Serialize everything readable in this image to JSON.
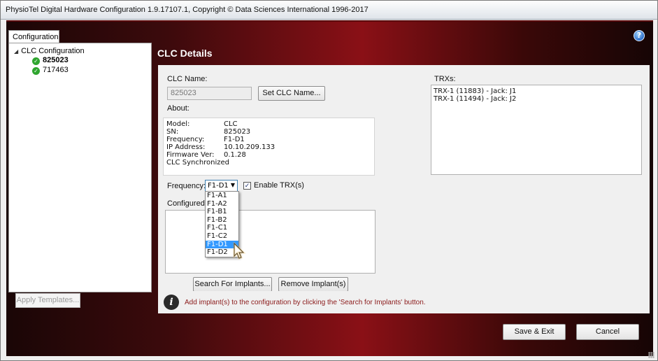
{
  "window": {
    "title": "PhysioTel Digital Hardware Configuration 1.9.17107.1, Copyright © Data Sciences International 1996-2017"
  },
  "help_icon": "help-icon",
  "sidebar": {
    "tab_label": "Configuration",
    "tree_root": "CLC Configuration",
    "tree_items": [
      {
        "label": "825023",
        "status": "ok",
        "selected": true
      },
      {
        "label": "717463",
        "status": "ok",
        "selected": false
      }
    ],
    "apply_templates_label": "Apply Templates..."
  },
  "main": {
    "header": "CLC Details",
    "clc_name_label": "CLC Name:",
    "clc_name_value": "825023",
    "set_name_button": "Set CLC Name...",
    "about_label": "About:",
    "about": {
      "model_label": "Model:",
      "model": "CLC",
      "sn_label": "SN:",
      "sn": "825023",
      "freq_label": "Frequency:",
      "freq": "F1-D1",
      "ip_label": "IP Address:",
      "ip": "10.10.209.133",
      "fw_label": "Firmware Ver:",
      "fw": "0.1.28",
      "sync_status": "CLC Synchronized"
    },
    "frequency_label": "Frequency:",
    "frequency_selected": "F1-D1",
    "frequency_options": [
      "F1-A1",
      "F1-A2",
      "F1-B1",
      "F1-B2",
      "F1-C1",
      "F1-C2",
      "F1-D1",
      "F1-D2"
    ],
    "enable_trx_label": "Enable TRX(s)",
    "enable_trx_checked": true,
    "configured_label": "Configured I",
    "search_button": "Search For Implants...",
    "remove_button": "Remove Implant(s)",
    "trxs_label": "TRXs:",
    "trxs": [
      "TRX-1 (11883) - Jack: J1",
      "TRX-1 (11494) - Jack: J2"
    ]
  },
  "info": {
    "icon": "info-icon",
    "text": "Add implant(s) to the configuration by clicking the 'Search for Implants' button."
  },
  "footer": {
    "save_exit": "Save & Exit",
    "cancel": "Cancel"
  }
}
